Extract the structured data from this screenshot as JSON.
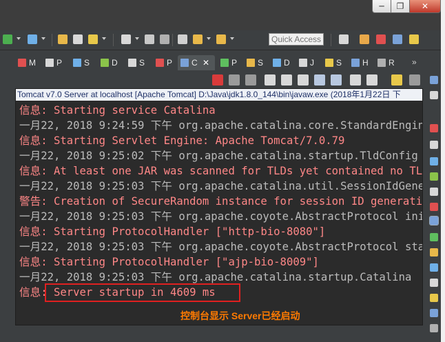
{
  "window": {
    "minimize_glyph": "─",
    "maximize_glyph": "❐",
    "close_glyph": "✕"
  },
  "toolbar": {
    "quick_access_placeholder": "Quick Access"
  },
  "view_tabs": [
    {
      "label": "M",
      "icon": "markers-icon",
      "color": "#e05050"
    },
    {
      "label": "P",
      "icon": "properties-icon",
      "color": "#d8d8d8"
    },
    {
      "label": "S",
      "icon": "servers-icon",
      "color": "#6fb0e8"
    },
    {
      "label": "D",
      "icon": "data-source-icon",
      "color": "#8bc34a"
    },
    {
      "label": "S",
      "icon": "snippets-icon",
      "color": "#d8d8d8"
    },
    {
      "label": "P",
      "icon": "problems-icon",
      "color": "#e05050"
    },
    {
      "label": "C",
      "icon": "console-icon",
      "color": "#7aa2d8",
      "active": true,
      "close_glyph": "✕"
    },
    {
      "label": "P",
      "icon": "progress-icon",
      "color": "#5fbf5f"
    },
    {
      "label": "S",
      "icon": "search-icon",
      "color": "#e8b84a"
    },
    {
      "label": "D",
      "icon": "debug-icon",
      "color": "#6fb0e8"
    },
    {
      "label": "J",
      "icon": "javadoc-icon",
      "color": "#d8d8d8"
    },
    {
      "label": "S",
      "icon": "source-icon",
      "color": "#e8c84a"
    },
    {
      "label": "H",
      "icon": "history-icon",
      "color": "#7aa2d8"
    },
    {
      "label": "R",
      "icon": "remote-icon",
      "color": "#b0b0b0"
    }
  ],
  "tab_overflow": "»",
  "console": {
    "header": "Tomcat v7.0 Server at localhost [Apache Tomcat] D:\\Java\\jdk1.8.0_144\\bin\\javaw.exe (2018年1月22日 下",
    "lines": [
      {
        "text": "信息: Starting service Catalina",
        "kind": "info"
      },
      {
        "text": "一月22, 2018 9:24:59 下午 org.apache.catalina.core.StandardEngine",
        "kind": "plain"
      },
      {
        "text": "信息: Starting Servlet Engine: Apache Tomcat/7.0.79",
        "kind": "info"
      },
      {
        "text": "一月22, 2018 9:25:02 下午 org.apache.catalina.startup.TldConfig",
        "kind": "plain"
      },
      {
        "text": "信息: At least one JAR was scanned for TLDs yet contained no TLDs",
        "kind": "info"
      },
      {
        "text": "一月22, 2018 9:25:03 下午 org.apache.catalina.util.SessionIdGenerator",
        "kind": "plain"
      },
      {
        "text": "警告: Creation of SecureRandom instance for session ID generation",
        "kind": "info"
      },
      {
        "text": "一月22, 2018 9:25:03 下午 org.apache.coyote.AbstractProtocol init",
        "kind": "plain"
      },
      {
        "text": "信息: Starting ProtocolHandler [\"http-bio-8080\"]",
        "kind": "info"
      },
      {
        "text": "一月22, 2018 9:25:03 下午 org.apache.coyote.AbstractProtocol start",
        "kind": "plain"
      },
      {
        "text": "信息: Starting ProtocolHandler [\"ajp-bio-8009\"]",
        "kind": "info"
      },
      {
        "text": "一月22, 2018 9:25:03 下午 org.apache.catalina.startup.Catalina",
        "kind": "plain"
      },
      {
        "text": "信息: Server startup in 4609 ms",
        "kind": "info"
      }
    ]
  },
  "annotation": {
    "caption": "控制台显示 Server已经启动",
    "box_color": "#e02020",
    "caption_color": "#ff7a00"
  },
  "colors": {
    "console_background": "#2b2b2b",
    "info_text": "#ff8787",
    "plain_text": "#bbbbbb",
    "header_text": "#1d2f66"
  }
}
